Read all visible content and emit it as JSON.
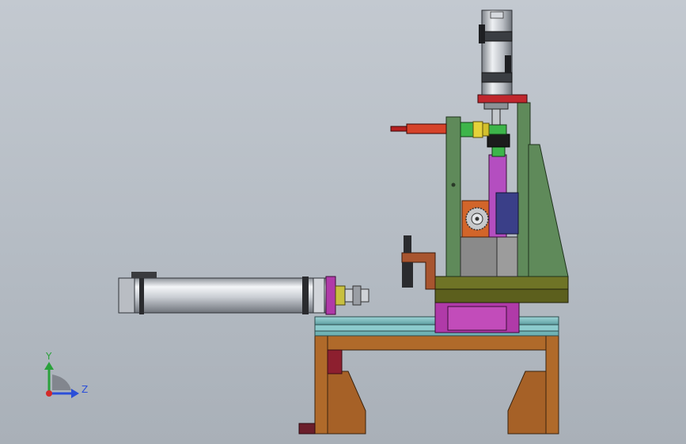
{
  "viewport": {
    "background_top": "#c3c9d0",
    "background_bottom": "#a9b0b8"
  },
  "model": {
    "colors": {
      "frame_brown": "#b06a2a",
      "base_olive": "#5c5f1d",
      "slide_teal": "#7fbfc2",
      "carriage_magenta": "#b03aa8",
      "column_green": "#5f8a5a",
      "block_grey": "#8a8a8a",
      "motor_silver": "#c8ccd2",
      "flange_red": "#c0272d",
      "coupling_yellow": "#e5d23a",
      "connector_green": "#3db54a",
      "clamp_copper": "#a8552f",
      "gear_orange": "#d2652a",
      "cylinder_silver": "#d6d9de",
      "dark_red_stub": "#6b1e2b"
    },
    "components": [
      "base-frame",
      "linear-slide-rail",
      "sliding-carriage",
      "upright-column",
      "support-gusset",
      "top-servo-motor",
      "horizontal-cylinder",
      "side-clamp-bracket",
      "gear-drive",
      "red-push-rod"
    ]
  },
  "triad": {
    "y_label": "Y",
    "z_label": "Z",
    "y_color": "#2aa13b",
    "z_color": "#2b4fd8",
    "x_color": "#d42a2a"
  }
}
